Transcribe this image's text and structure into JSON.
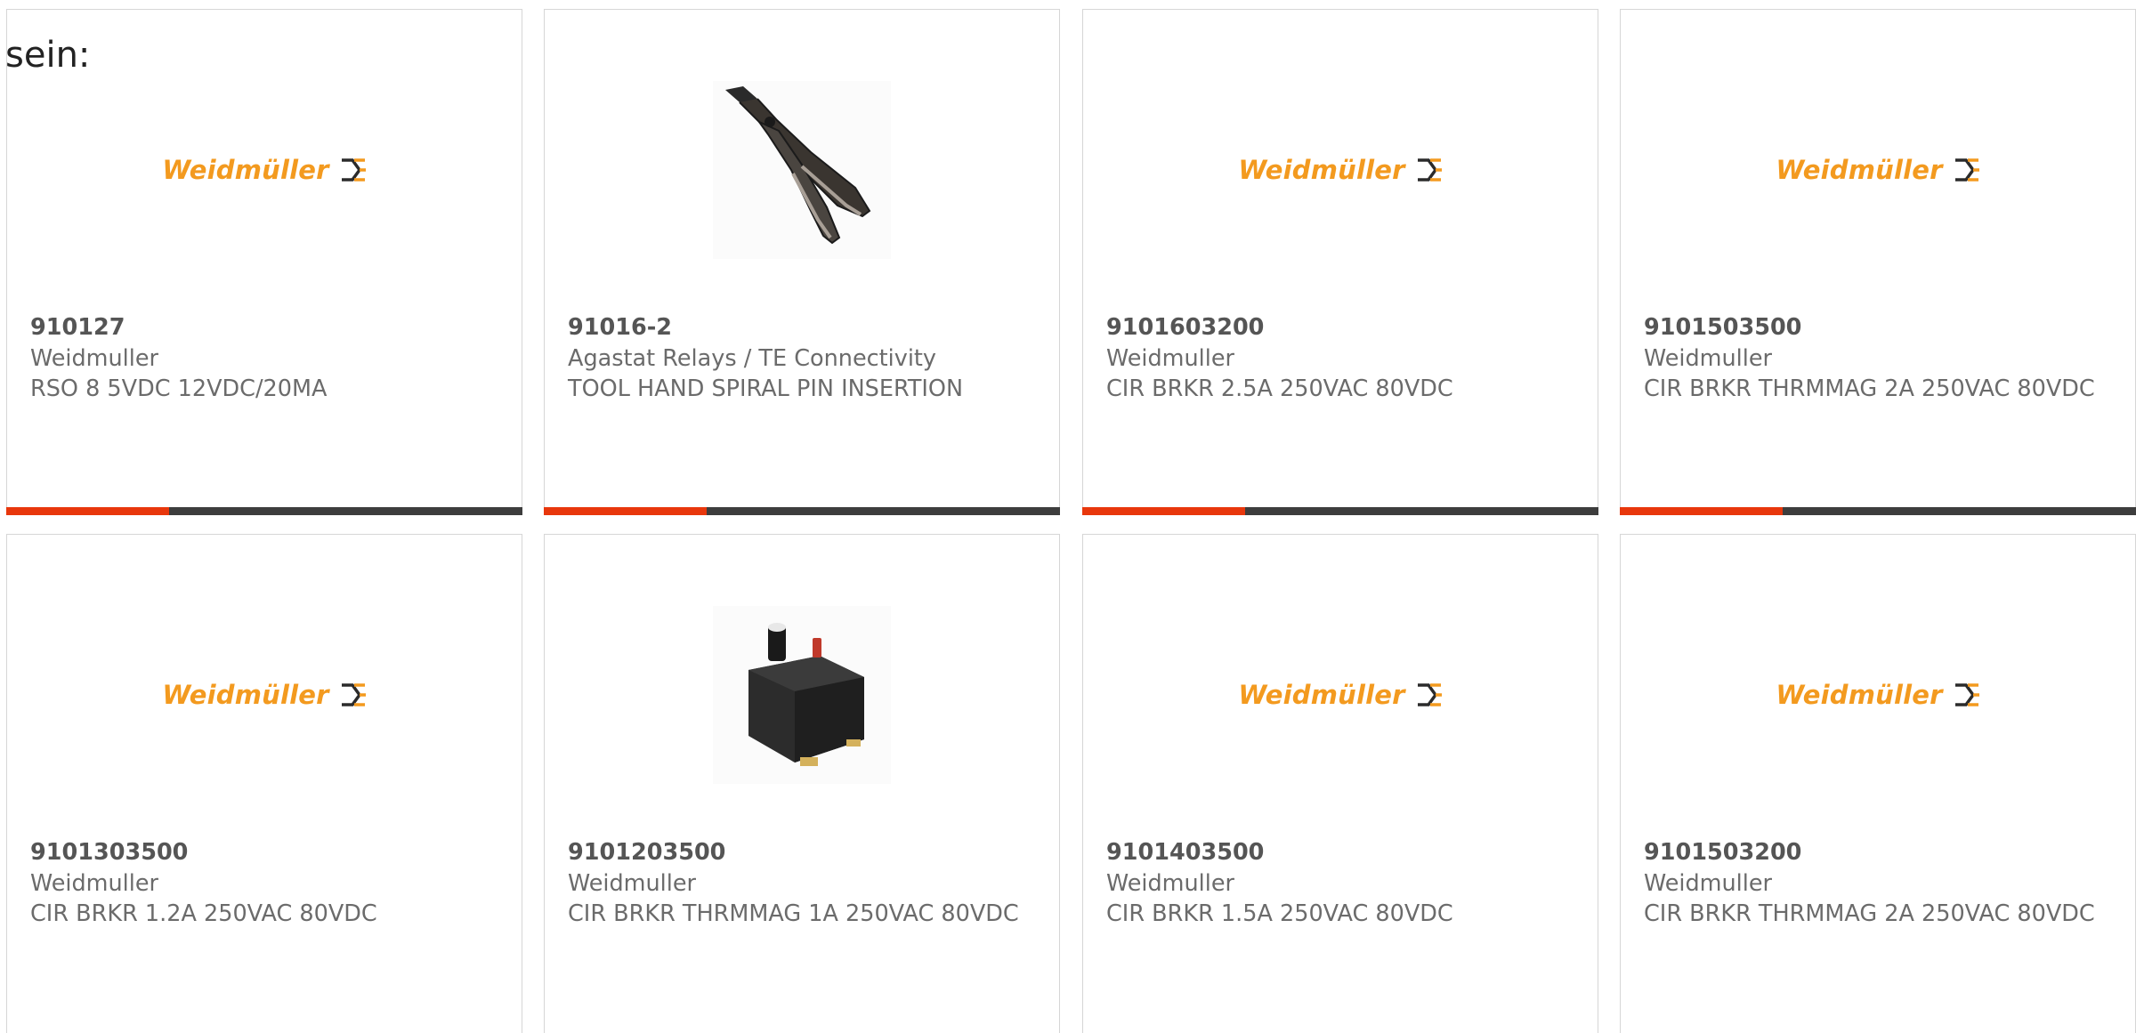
{
  "lead_text": "sein:",
  "colors": {
    "accent": "#e8370c",
    "bar_dark": "#3d3d3d",
    "logo_orange": "#f39a1f",
    "text_gray": "#6b6b6b"
  },
  "products": [
    {
      "part_no": "910127",
      "manufacturer": "Weidmuller",
      "description": "RSO 8 5VDC 12VDC/20MA",
      "image": "weidmuller-logo",
      "logo_text": "Weidmüller"
    },
    {
      "part_no": "91016-2",
      "manufacturer": "Agastat Relays / TE Connectivity",
      "description": "TOOL HAND SPIRAL PIN INSERTION",
      "image": "hand-tool-photo"
    },
    {
      "part_no": "9101603200",
      "manufacturer": "Weidmuller",
      "description": "CIR BRKR 2.5A 250VAC 80VDC",
      "image": "weidmuller-logo",
      "logo_text": "Weidmüller"
    },
    {
      "part_no": "9101503500",
      "manufacturer": "Weidmuller",
      "description": "CIR BRKR THRMMAG 2A 250VAC 80VDC",
      "image": "weidmuller-logo",
      "logo_text": "Weidmüller"
    },
    {
      "part_no": "9101303500",
      "manufacturer": "Weidmuller",
      "description": "CIR BRKR 1.2A 250VAC 80VDC",
      "image": "weidmuller-logo",
      "logo_text": "Weidmüller"
    },
    {
      "part_no": "9101203500",
      "manufacturer": "Weidmuller",
      "description": "CIR BRKR THRMMAG 1A 250VAC 80VDC",
      "image": "circuit-breaker-photo"
    },
    {
      "part_no": "9101403500",
      "manufacturer": "Weidmuller",
      "description": "CIR BRKR 1.5A 250VAC 80VDC",
      "image": "weidmuller-logo",
      "logo_text": "Weidmüller"
    },
    {
      "part_no": "9101503200",
      "manufacturer": "Weidmuller",
      "description": "CIR BRKR THRMMAG 2A 250VAC 80VDC",
      "image": "weidmuller-logo",
      "logo_text": "Weidmüller"
    }
  ]
}
